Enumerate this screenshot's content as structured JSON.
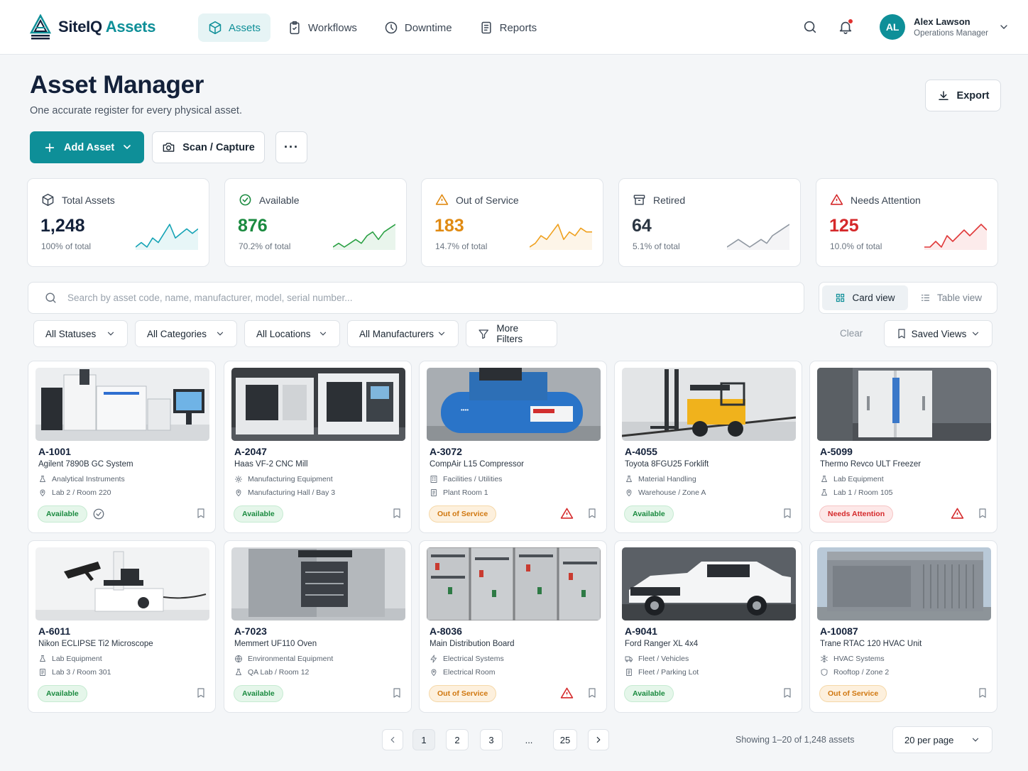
{
  "app": {
    "brand_part1": "SiteIQ",
    "brand_part2": "Assets",
    "accent": "#0e8f98"
  },
  "nav": [
    {
      "label": "Assets",
      "icon": "cube-icon",
      "active": true
    },
    {
      "label": "Workflows",
      "icon": "clipboard-icon",
      "active": false
    },
    {
      "label": "Downtime",
      "icon": "clock-icon",
      "active": false
    },
    {
      "label": "Reports",
      "icon": "report-icon",
      "active": false
    }
  ],
  "user": {
    "initials": "AL",
    "name": "Alex Lawson",
    "role": "Operations Manager"
  },
  "header": {
    "title": "Asset Manager",
    "subtitle": "One accurate register for every physical asset.",
    "export_label": "Export",
    "add_label": "Add Asset",
    "scan_label": "Scan / Capture",
    "more_label": "···"
  },
  "stats": [
    {
      "label": "Total Assets",
      "value": "1,248",
      "pct": "100% of total",
      "color": "#13213a",
      "spark_color": "#14a3b5",
      "trend": [
        3,
        4,
        3,
        5,
        4,
        6,
        8,
        5,
        6,
        7,
        6,
        7
      ]
    },
    {
      "label": "Available",
      "value": "876",
      "pct": "70.2% of total",
      "color": "#1a8a3f",
      "spark_color": "#2aa043",
      "trend": [
        2,
        3,
        2,
        3,
        4,
        3,
        5,
        6,
        4,
        6,
        7,
        8
      ]
    },
    {
      "label": "Out of Service",
      "value": "183",
      "pct": "14.7% of total",
      "color": "#e08a12",
      "spark_color": "#efa01d",
      "trend": [
        2,
        3,
        5,
        4,
        6,
        8,
        4,
        6,
        5,
        7,
        6,
        6
      ]
    },
    {
      "label": "Retired",
      "value": "64",
      "pct": "5.1% of total",
      "color": "#2a3542",
      "spark_color": "#9098a2",
      "trend": [
        3,
        4,
        5,
        4,
        3,
        4,
        5,
        4,
        6,
        7,
        8,
        9
      ]
    },
    {
      "label": "Needs Attention",
      "value": "125",
      "pct": "10.0% of total",
      "color": "#d5292b",
      "spark_color": "#e0393a",
      "trend": [
        3,
        3,
        4,
        3,
        5,
        4,
        5,
        6,
        5,
        6,
        7,
        6
      ]
    }
  ],
  "search": {
    "placeholder": "Search by asset code, name, manufacturer, model, serial number..."
  },
  "views": {
    "card": "Card view",
    "table": "Table view",
    "active": "card"
  },
  "filters": {
    "statuses": "All Statuses",
    "categories": "All Categories",
    "locations": "All Locations",
    "manufacturers": "All Manufacturers",
    "more": "More Filters",
    "clear": "Clear",
    "saved": "Saved Views"
  },
  "assets": [
    {
      "code": "A-1001",
      "name": "Agilent 7890B GC System",
      "category": "Analytical Instruments",
      "location": "Lab 2 / Room 220",
      "status": "Available",
      "status_class": "available",
      "image": "gc-system",
      "cat_icon": "flask-icon",
      "loc_icon": "pin-icon",
      "verified": true,
      "warning": false
    },
    {
      "code": "A-2047",
      "name": "Haas VF-2 CNC Mill",
      "category": "Manufacturing Equipment",
      "location": "Manufacturing Hall / Bay 3",
      "status": "Available",
      "status_class": "available",
      "image": "cnc-mill",
      "cat_icon": "gear-icon",
      "loc_icon": "pin-icon",
      "verified": false,
      "warning": false
    },
    {
      "code": "A-3072",
      "name": "CompAir L15 Compressor",
      "category": "Facilities / Utilities",
      "location": "Plant Room 1",
      "status": "Out of Service",
      "status_class": "outofservice",
      "image": "compressor",
      "cat_icon": "building-icon",
      "loc_icon": "doc-icon",
      "verified": false,
      "warning": true
    },
    {
      "code": "A-4055",
      "name": "Toyota 8FGU25 Forklift",
      "category": "Material Handling",
      "location": "Warehouse / Zone A",
      "status": "Available",
      "status_class": "available",
      "image": "forklift",
      "cat_icon": "flask-icon",
      "loc_icon": "pin-icon",
      "verified": false,
      "warning": false
    },
    {
      "code": "A-5099",
      "name": "Thermo Revco ULT Freezer",
      "category": "Lab Equipment",
      "location": "Lab 1 / Room 105",
      "status": "Needs Attention",
      "status_class": "attention",
      "image": "freezer",
      "cat_icon": "flask-icon",
      "loc_icon": "flask-icon",
      "verified": false,
      "warning": true
    },
    {
      "code": "A-6011",
      "name": "Nikon ECLIPSE Ti2 Microscope",
      "category": "Lab Equipment",
      "location": "Lab 3 / Room 301",
      "status": "Available",
      "status_class": "available",
      "image": "microscope",
      "cat_icon": "flask-icon",
      "loc_icon": "doc-icon",
      "verified": false,
      "warning": false
    },
    {
      "code": "A-7023",
      "name": "Memmert UF110 Oven",
      "category": "Environmental Equipment",
      "location": "QA Lab / Room 12",
      "status": "Available",
      "status_class": "available",
      "image": "oven",
      "cat_icon": "globe-icon",
      "loc_icon": "flask-icon",
      "verified": false,
      "warning": false
    },
    {
      "code": "A-8036",
      "name": "Main Distribution Board",
      "category": "Electrical Systems",
      "location": "Electrical Room",
      "status": "Out of Service",
      "status_class": "outofservice",
      "image": "distribution-board",
      "cat_icon": "bolt-icon",
      "loc_icon": "pin-icon",
      "verified": false,
      "warning": true
    },
    {
      "code": "A-9041",
      "name": "Ford Ranger XL 4x4",
      "category": "Fleet / Vehicles",
      "location": "Fleet / Parking Lot",
      "status": "Available",
      "status_class": "available",
      "image": "pickup-truck",
      "cat_icon": "truck-icon",
      "loc_icon": "doc-icon",
      "verified": false,
      "warning": false
    },
    {
      "code": "A-10087",
      "name": "Trane RTAC 120 HVAC Unit",
      "category": "HVAC Systems",
      "location": "Rooftop / Zone 2",
      "status": "Out of Service",
      "status_class": "outofservice",
      "image": "hvac-unit",
      "cat_icon": "snowflake-icon",
      "loc_icon": "shield-icon",
      "verified": false,
      "warning": false
    }
  ],
  "pagination": {
    "pages": [
      "1",
      "2",
      "3",
      "...",
      "25"
    ],
    "current": "1",
    "showing": "Showing 1–20 of 1,248 assets",
    "per_page": "20 per page"
  }
}
